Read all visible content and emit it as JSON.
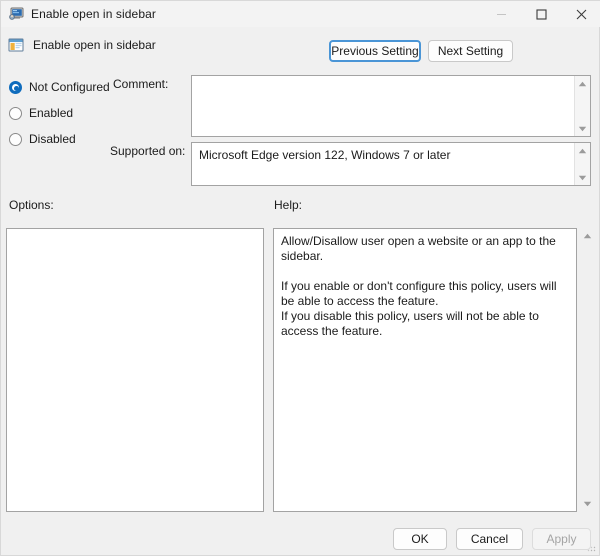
{
  "window": {
    "title": "Enable open in sidebar",
    "title_icon": "policy-computer-icon",
    "controls": {
      "minimize_icon": "minimize-icon",
      "maximize_icon": "maximize-icon",
      "close_icon": "close-icon"
    }
  },
  "policy_header": {
    "icon": "policy-setting-icon",
    "title": "Enable open in sidebar"
  },
  "navigation": {
    "previous_label": "Previous Setting",
    "next_label": "Next Setting"
  },
  "state_options": [
    {
      "label": "Not Configured",
      "selected": true
    },
    {
      "label": "Enabled",
      "selected": false
    },
    {
      "label": "Disabled",
      "selected": false
    }
  ],
  "comment": {
    "label": "Comment:",
    "value": "",
    "scroll_up_icon": "scroll-up-arrow-icon",
    "scroll_down_icon": "scroll-down-arrow-icon"
  },
  "supported_on": {
    "label": "Supported on:",
    "value": "Microsoft Edge version 122, Windows 7 or later",
    "scroll_up_icon": "scroll-up-arrow-icon",
    "scroll_down_icon": "scroll-down-arrow-icon"
  },
  "options": {
    "label": "Options:",
    "value": ""
  },
  "help": {
    "label": "Help:",
    "text": "Allow/Disallow user open a website or an app to the sidebar.\n\nIf you enable or don't configure this policy, users will be able to access the feature.\nIf you disable this policy, users will not be able to access the feature.",
    "scroll_up_icon": "scroll-up-arrow-icon",
    "scroll_down_icon": "scroll-down-arrow-icon"
  },
  "footer": {
    "ok_label": "OK",
    "cancel_label": "Cancel",
    "apply_label": "Apply",
    "apply_disabled": true
  },
  "colors": {
    "accent": "#0f6cbd",
    "focus_border": "#4a95d6",
    "dialog_background": "#f0f0f0",
    "field_background": "#ffffff",
    "text": "#1b1b1b",
    "disabled_text": "#a5a5a5"
  }
}
